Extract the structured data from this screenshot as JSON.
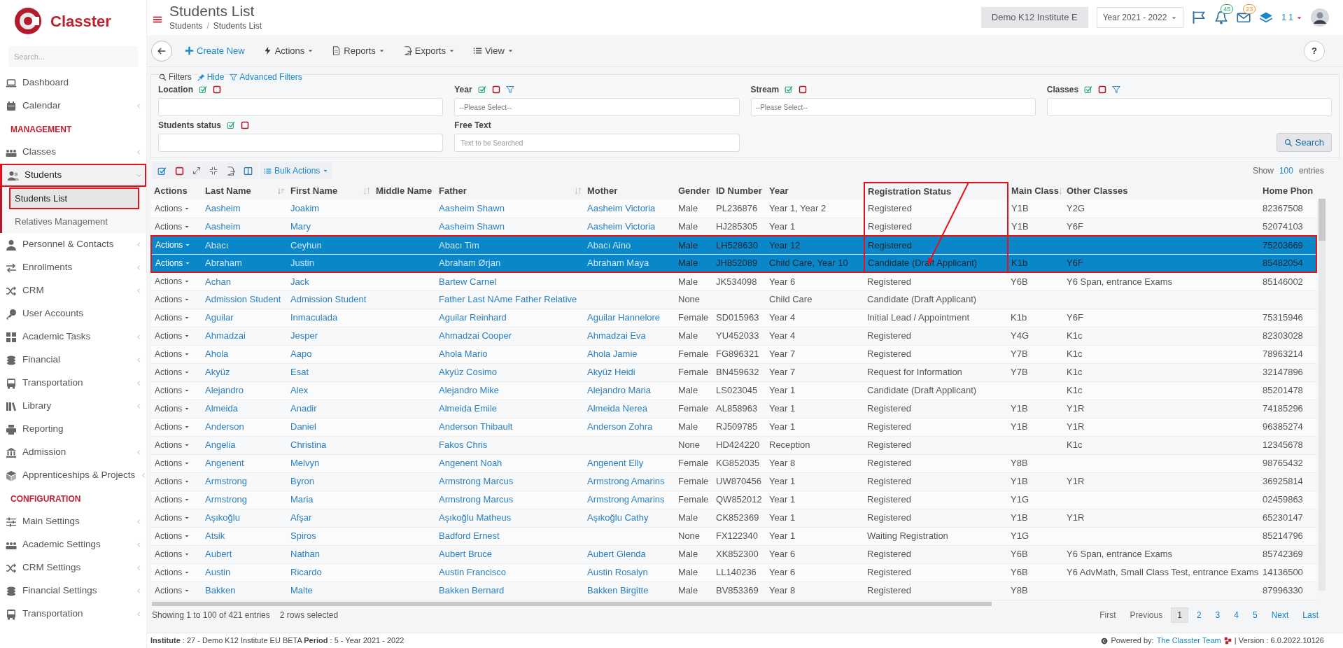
{
  "sidebar": {
    "logo": "Classter",
    "search_placeholder": "Search...",
    "items": [
      {
        "kind": "item",
        "label": "Dashboard",
        "submenu": false,
        "expanded": false,
        "outlined": false
      },
      {
        "kind": "item",
        "label": "Calendar",
        "submenu": true,
        "expanded": false,
        "outlined": false
      },
      {
        "kind": "heading",
        "label": "MANAGEMENT"
      },
      {
        "kind": "item",
        "label": "Classes",
        "submenu": true,
        "expanded": false,
        "outlined": false
      },
      {
        "kind": "item",
        "label": "Students",
        "submenu": true,
        "expanded": true,
        "outlined": true,
        "children": [
          {
            "label": "Students List",
            "selected": true,
            "outlined": true
          },
          {
            "label": "Relatives Management",
            "selected": false,
            "outlined": false
          }
        ]
      },
      {
        "kind": "item",
        "label": "Personnel & Contacts",
        "submenu": true,
        "expanded": false,
        "outlined": false
      },
      {
        "kind": "item",
        "label": "Enrollments",
        "submenu": true,
        "expanded": false,
        "outlined": false
      },
      {
        "kind": "item",
        "label": "CRM",
        "submenu": true,
        "expanded": false,
        "outlined": false
      },
      {
        "kind": "item",
        "label": "User Accounts",
        "submenu": false,
        "expanded": false,
        "outlined": false
      },
      {
        "kind": "item",
        "label": "Academic Tasks",
        "submenu": true,
        "expanded": false,
        "outlined": false
      },
      {
        "kind": "item",
        "label": "Financial",
        "submenu": true,
        "expanded": false,
        "outlined": false
      },
      {
        "kind": "item",
        "label": "Transportation",
        "submenu": true,
        "expanded": false,
        "outlined": false
      },
      {
        "kind": "item",
        "label": "Library",
        "submenu": true,
        "expanded": false,
        "outlined": false
      },
      {
        "kind": "item",
        "label": "Reporting",
        "submenu": false,
        "expanded": false,
        "outlined": false
      },
      {
        "kind": "item",
        "label": "Admission",
        "submenu": true,
        "expanded": false,
        "outlined": false
      },
      {
        "kind": "item",
        "label": "Apprenticeships & Projects",
        "submenu": true,
        "expanded": false,
        "outlined": false
      },
      {
        "kind": "heading",
        "label": "CONFIGURATION"
      },
      {
        "kind": "item",
        "label": "Main Settings",
        "submenu": true,
        "expanded": false,
        "outlined": false
      },
      {
        "kind": "item",
        "label": "Academic Settings",
        "submenu": true,
        "expanded": false,
        "outlined": false
      },
      {
        "kind": "item",
        "label": "CRM Settings",
        "submenu": true,
        "expanded": false,
        "outlined": false
      },
      {
        "kind": "item",
        "label": "Financial Settings",
        "submenu": true,
        "expanded": false,
        "outlined": false
      },
      {
        "kind": "item",
        "label": "Transportation",
        "submenu": true,
        "expanded": false,
        "outlined": false
      }
    ]
  },
  "header": {
    "title": "Students List",
    "breadcrumb": [
      "Students",
      "Students List"
    ],
    "breadcrumb_separator": "/",
    "institute": "Demo K12 Institute E",
    "year": "Year 2021 - 2022",
    "notifications": "45",
    "messages": "23",
    "user": "1 1"
  },
  "toolbar": {
    "actions": [
      {
        "label": "Create New",
        "kind": "create",
        "dropdown": false
      },
      {
        "label": "Actions",
        "kind": "actions",
        "dropdown": true
      },
      {
        "label": "Reports",
        "kind": "reports",
        "dropdown": true
      },
      {
        "label": "Exports",
        "kind": "exports",
        "dropdown": true
      },
      {
        "label": "View",
        "kind": "view",
        "dropdown": true
      }
    ],
    "help": "?"
  },
  "filters": {
    "title": "Filters",
    "hide": "Hide",
    "advanced": "Advanced Filters",
    "search": "Search",
    "fields": [
      {
        "label": "Location",
        "kind": "text",
        "toggles": true,
        "funnel": false
      },
      {
        "label": "Year",
        "kind": "select",
        "placeholder": "--Please Select--",
        "toggles": true,
        "funnel": true
      },
      {
        "label": "Stream",
        "kind": "select",
        "placeholder": "--Please Select--",
        "toggles": true,
        "funnel": false
      },
      {
        "label": "Classes",
        "kind": "text",
        "toggles": true,
        "funnel": true
      },
      {
        "label": "Students status",
        "kind": "text",
        "toggles": true,
        "funnel": false
      },
      {
        "label": "Free Text",
        "kind": "text",
        "placeholder": "Text to be Searched",
        "toggles": false,
        "funnel": false
      }
    ]
  },
  "table": {
    "bulk_actions": "Bulk Actions",
    "show": "Show",
    "page_size": "100",
    "entries": "entries",
    "annotation_arrow": true,
    "columns": [
      {
        "label": "Actions",
        "sortable": false,
        "sorted": false,
        "outlined": false
      },
      {
        "label": "Last Name",
        "sortable": true,
        "sorted": true,
        "outlined": false
      },
      {
        "label": "First Name",
        "sortable": true,
        "sorted": false,
        "outlined": false
      },
      {
        "label": "Middle Name",
        "sortable": false,
        "sorted": false,
        "outlined": false
      },
      {
        "label": "Father",
        "sortable": true,
        "sorted": false,
        "outlined": false
      },
      {
        "label": "Mother",
        "sortable": false,
        "sorted": false,
        "outlined": false
      },
      {
        "label": "Gender",
        "sortable": false,
        "sorted": false,
        "outlined": false
      },
      {
        "label": "ID Number",
        "sortable": false,
        "sorted": false,
        "outlined": false
      },
      {
        "label": "Year",
        "sortable": false,
        "sorted": false,
        "outlined": false
      },
      {
        "label": "Registration Status",
        "sortable": false,
        "sorted": false,
        "outlined": true
      },
      {
        "label": "Main Class",
        "sortable": true,
        "sorted": false,
        "outlined": false
      },
      {
        "label": "Other Classes",
        "sortable": false,
        "sorted": false,
        "outlined": false
      },
      {
        "label": "Home Phon",
        "sortable": false,
        "sorted": false,
        "outlined": false
      }
    ],
    "rows": [
      {
        "action": "Actions",
        "last_name": "Aasheim",
        "first_name": "Joakim",
        "father": "Aasheim Shawn",
        "mother": "Aasheim Victoria",
        "gender": "Male",
        "id_number": "PL236876",
        "year": "Year 1, Year 2",
        "registration_status": "Registered",
        "main_class": "Y1B",
        "other_classes": "Y2G",
        "home_phone": "82367508",
        "selected": false,
        "outlined": false
      },
      {
        "action": "Actions",
        "last_name": "Aasheim",
        "first_name": "Mary",
        "father": "Aasheim Shawn",
        "mother": "Aasheim Victoria",
        "gender": "Male",
        "id_number": "HJ285305",
        "year": "Year 1",
        "registration_status": "Registered",
        "main_class": "Y1B",
        "other_classes": "Y6F",
        "home_phone": "52074103",
        "selected": false,
        "outlined": false
      },
      {
        "action": "Actions",
        "last_name": "Abacı",
        "first_name": "Ceyhun",
        "father": "Abacı Tim",
        "mother": "Abacı Aino",
        "gender": "Male",
        "id_number": "LH528630",
        "year": "Year 12",
        "registration_status": "Registered",
        "home_phone": "75203669",
        "selected": true,
        "outlined": true
      },
      {
        "action": "Actions",
        "last_name": "Abraham",
        "first_name": "Justin",
        "father": "Abraham Ørjan",
        "mother": "Abraham Maya",
        "gender": "Male",
        "id_number": "JH852089",
        "year": "Child Care, Year 10",
        "registration_status": "Candidate (Draft Applicant)",
        "main_class": "K1b",
        "other_classes": "Y6F",
        "home_phone": "85482054",
        "selected": true,
        "outlined": true
      },
      {
        "action": "Actions",
        "last_name": "Achan",
        "first_name": "Jack",
        "father": "Bartew Carnel",
        "gender": "Male",
        "id_number": "JK534098",
        "year": "Year 6",
        "registration_status": "Registered",
        "main_class": "Y6B",
        "other_classes": "Y6 Span, entrance Exams",
        "home_phone": "85146002",
        "selected": false,
        "outlined": false
      },
      {
        "action": "Actions",
        "last_name": "Admission Student",
        "first_name": "Admission Student",
        "father": "Father Last NAme Father Relative",
        "gender": "None",
        "year": "Child Care",
        "registration_status": "Candidate (Draft Applicant)",
        "selected": false,
        "outlined": false
      },
      {
        "action": "Actions",
        "last_name": "Aguilar",
        "first_name": "Inmaculada",
        "father": "Aguilar Reinhard",
        "mother": "Aguilar Hannelore",
        "gender": "Female",
        "id_number": "SD015963",
        "year": "Year 4",
        "registration_status": "Initial Lead / Appointment",
        "main_class": "K1b",
        "other_classes": "Y6F",
        "home_phone": "75315946",
        "selected": false,
        "outlined": false
      },
      {
        "action": "Actions",
        "last_name": "Ahmadzai",
        "first_name": "Jesper",
        "father": "Ahmadzai Cooper",
        "mother": "Ahmadzai Eva",
        "gender": "Male",
        "id_number": "YU452033",
        "year": "Year 4",
        "registration_status": "Registered",
        "main_class": "Y4G",
        "other_classes": "K1c",
        "home_phone": "82303028",
        "selected": false,
        "outlined": false
      },
      {
        "action": "Actions",
        "last_name": "Ahola",
        "first_name": "Aapo",
        "father": "Ahola Mario",
        "mother": "Ahola Jamie",
        "gender": "Female",
        "id_number": "FG896321",
        "year": "Year 7",
        "registration_status": "Registered",
        "main_class": "Y7B",
        "other_classes": "K1c",
        "home_phone": "78963214",
        "selected": false,
        "outlined": false
      },
      {
        "action": "Actions",
        "last_name": "Akyüz",
        "first_name": "Esat",
        "father": "Akyüz Cosimo",
        "mother": "Akyüz Heidi",
        "gender": "Female",
        "id_number": "BN459632",
        "year": "Year 7",
        "registration_status": "Request for Information",
        "main_class": "Y7B",
        "other_classes": "K1c",
        "home_phone": "32147896",
        "selected": false,
        "outlined": false
      },
      {
        "action": "Actions",
        "last_name": "Alejandro",
        "first_name": "Alex",
        "father": "Alejandro Mike",
        "mother": "Alejandro Maria",
        "gender": "Male",
        "id_number": "LS023045",
        "year": "Year 1",
        "registration_status": "Candidate (Draft Applicant)",
        "other_classes": "K1c",
        "home_phone": "85201478",
        "selected": false,
        "outlined": false
      },
      {
        "action": "Actions",
        "last_name": "Almeida",
        "first_name": "Anadir",
        "father": "Almeida Emile",
        "mother": "Almeida Nerea",
        "gender": "Female",
        "id_number": "AL858963",
        "year": "Year 1",
        "registration_status": "Registered",
        "main_class": "Y1B",
        "other_classes": "Y1R",
        "home_phone": "74185296",
        "selected": false,
        "outlined": false
      },
      {
        "action": "Actions",
        "last_name": "Anderson",
        "first_name": "Daniel",
        "father": "Anderson Thibault",
        "mother": "Anderson Zohra",
        "gender": "Male",
        "id_number": "RJ509785",
        "year": "Year 1",
        "registration_status": "Registered",
        "main_class": "Y1B",
        "other_classes": "Y1R",
        "home_phone": "96385274",
        "selected": false,
        "outlined": false
      },
      {
        "action": "Actions",
        "last_name": "Angelia",
        "first_name": "Christina",
        "father": "Fakos Chris",
        "gender": "None",
        "id_number": "HD424220",
        "year": "Reception",
        "registration_status": "Registered",
        "other_classes": "K1c",
        "home_phone": "12345678",
        "selected": false,
        "outlined": false
      },
      {
        "action": "Actions",
        "last_name": "Angenent",
        "first_name": "Melvyn",
        "father": "Angenent Noah",
        "mother": "Angenent Elly",
        "gender": "Female",
        "id_number": "KG852035",
        "year": "Year 8",
        "registration_status": "Registered",
        "main_class": "Y8B",
        "home_phone": "98765432",
        "selected": false,
        "outlined": false
      },
      {
        "action": "Actions",
        "last_name": "Armstrong",
        "first_name": "Byron",
        "father": "Armstrong Marcus",
        "mother": "Armstrong Amarins",
        "gender": "Female",
        "id_number": "UW870456",
        "year": "Year 1",
        "registration_status": "Registered",
        "main_class": "Y1B",
        "other_classes": "Y1R",
        "home_phone": "36925814",
        "selected": false,
        "outlined": false
      },
      {
        "action": "Actions",
        "last_name": "Armstrong",
        "first_name": "Maria",
        "father": "Armstrong Marcus",
        "mother": "Armstrong Amarins",
        "gender": "Female",
        "id_number": "QW852012",
        "year": "Year 1",
        "registration_status": "Registered",
        "main_class": "Y1G",
        "home_phone": "02459863",
        "selected": false,
        "outlined": false
      },
      {
        "action": "Actions",
        "last_name": "Aşıkoğlu",
        "first_name": "Afşar",
        "father": "Aşıkoğlu Matheus",
        "mother": "Aşıkoğlu Cathy",
        "gender": "Male",
        "id_number": "CK852369",
        "year": "Year 1",
        "registration_status": "Registered",
        "main_class": "Y1B",
        "other_classes": "Y1R",
        "home_phone": "65230147",
        "selected": false,
        "outlined": false
      },
      {
        "action": "Actions",
        "last_name": "Atsik",
        "first_name": "Spiros",
        "father": "Badford Ernest",
        "gender": "None",
        "id_number": "FX122340",
        "year": "Year 1",
        "registration_status": "Waiting Registration",
        "main_class": "Y1G",
        "home_phone": "85214796",
        "selected": false,
        "outlined": false
      },
      {
        "action": "Actions",
        "last_name": "Aubert",
        "first_name": "Nathan",
        "father": "Aubert Bruce",
        "mother": "Aubert Glenda",
        "gender": "Male",
        "id_number": "XK852300",
        "year": "Year 6",
        "registration_status": "Registered",
        "main_class": "Y6B",
        "other_classes": "Y6 Span, entrance Exams",
        "home_phone": "85742369",
        "selected": false,
        "outlined": false
      },
      {
        "action": "Actions",
        "last_name": "Austin",
        "first_name": "Ricardo",
        "father": "Austin Francisco",
        "mother": "Austin Rosalyn",
        "gender": "Male",
        "id_number": "LL140236",
        "year": "Year 6",
        "registration_status": "Registered",
        "main_class": "Y6B",
        "other_classes": "Y6 AdvMath, Small Class Test, entrance Exams",
        "home_phone": "14136500",
        "selected": false,
        "outlined": false
      },
      {
        "action": "Actions",
        "last_name": "Bakken",
        "first_name": "Malte",
        "father": "Bakken Bernard",
        "mother": "Bakken Birgitte",
        "gender": "Male",
        "id_number": "BV853369",
        "year": "Year 8",
        "registration_status": "Registered",
        "main_class": "Y8B",
        "home_phone": "87996330",
        "selected": false,
        "outlined": false
      }
    ],
    "info": "Showing 1 to 100 of 421 entries",
    "selection": "2 rows selected",
    "pagination": [
      {
        "label": "First",
        "selected": false
      },
      {
        "label": "Previous",
        "selected": false
      },
      {
        "label": "1",
        "selected": true
      },
      {
        "label": "2",
        "selected": false
      },
      {
        "label": "3",
        "selected": false
      },
      {
        "label": "4",
        "selected": false
      },
      {
        "label": "5",
        "selected": false
      },
      {
        "label": "Next",
        "selected": false
      },
      {
        "label": "Last",
        "selected": false
      }
    ]
  },
  "footer": {
    "text": "**Institute** : 27 - Demo K12 Institute EU BETA **Period** : 5 - Year 2021 - 2022",
    "powered_by": "Powered by:",
    "team": "The Classter Team",
    "version": "| Version : 6.0.2022.10126"
  }
}
